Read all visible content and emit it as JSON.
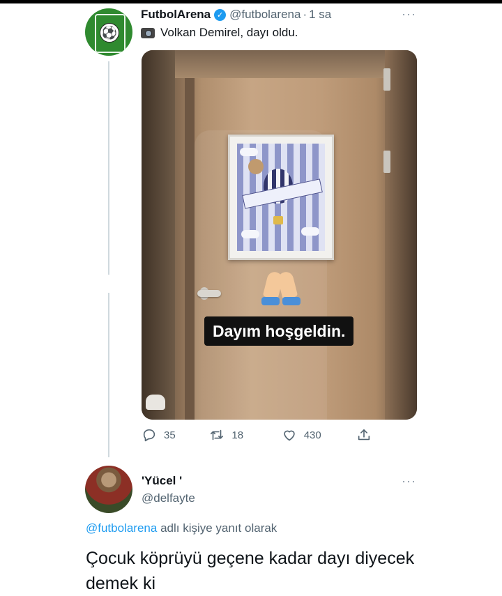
{
  "tweet": {
    "author_name": "FutbolArena",
    "handle": "@futbolarena",
    "separator": "·",
    "time": "1 sa",
    "text": "Volkan Demirel, dayı oldu.",
    "image": {
      "caption": "Dayım hoşgeldin."
    },
    "stats": {
      "replies": "35",
      "retweets": "18",
      "likes": "430"
    }
  },
  "reply": {
    "author_name": "'Yücel '",
    "handle": "@delfayte",
    "replying_to_handle": "@futbolarena",
    "replying_to_suffix": "adlı kişiye yanıt olarak",
    "text": "Çocuk köprüyü geçene kadar dayı diyecek demek ki"
  },
  "more_label": "···",
  "colors": {
    "accent": "#1d9bf0",
    "muted": "#536471",
    "thread_line": "#cfd9de"
  },
  "icons": [
    "verified-badge-icon",
    "camera-emoji-icon",
    "reply-icon",
    "retweet-icon",
    "like-icon",
    "share-icon",
    "more-options-icon"
  ]
}
